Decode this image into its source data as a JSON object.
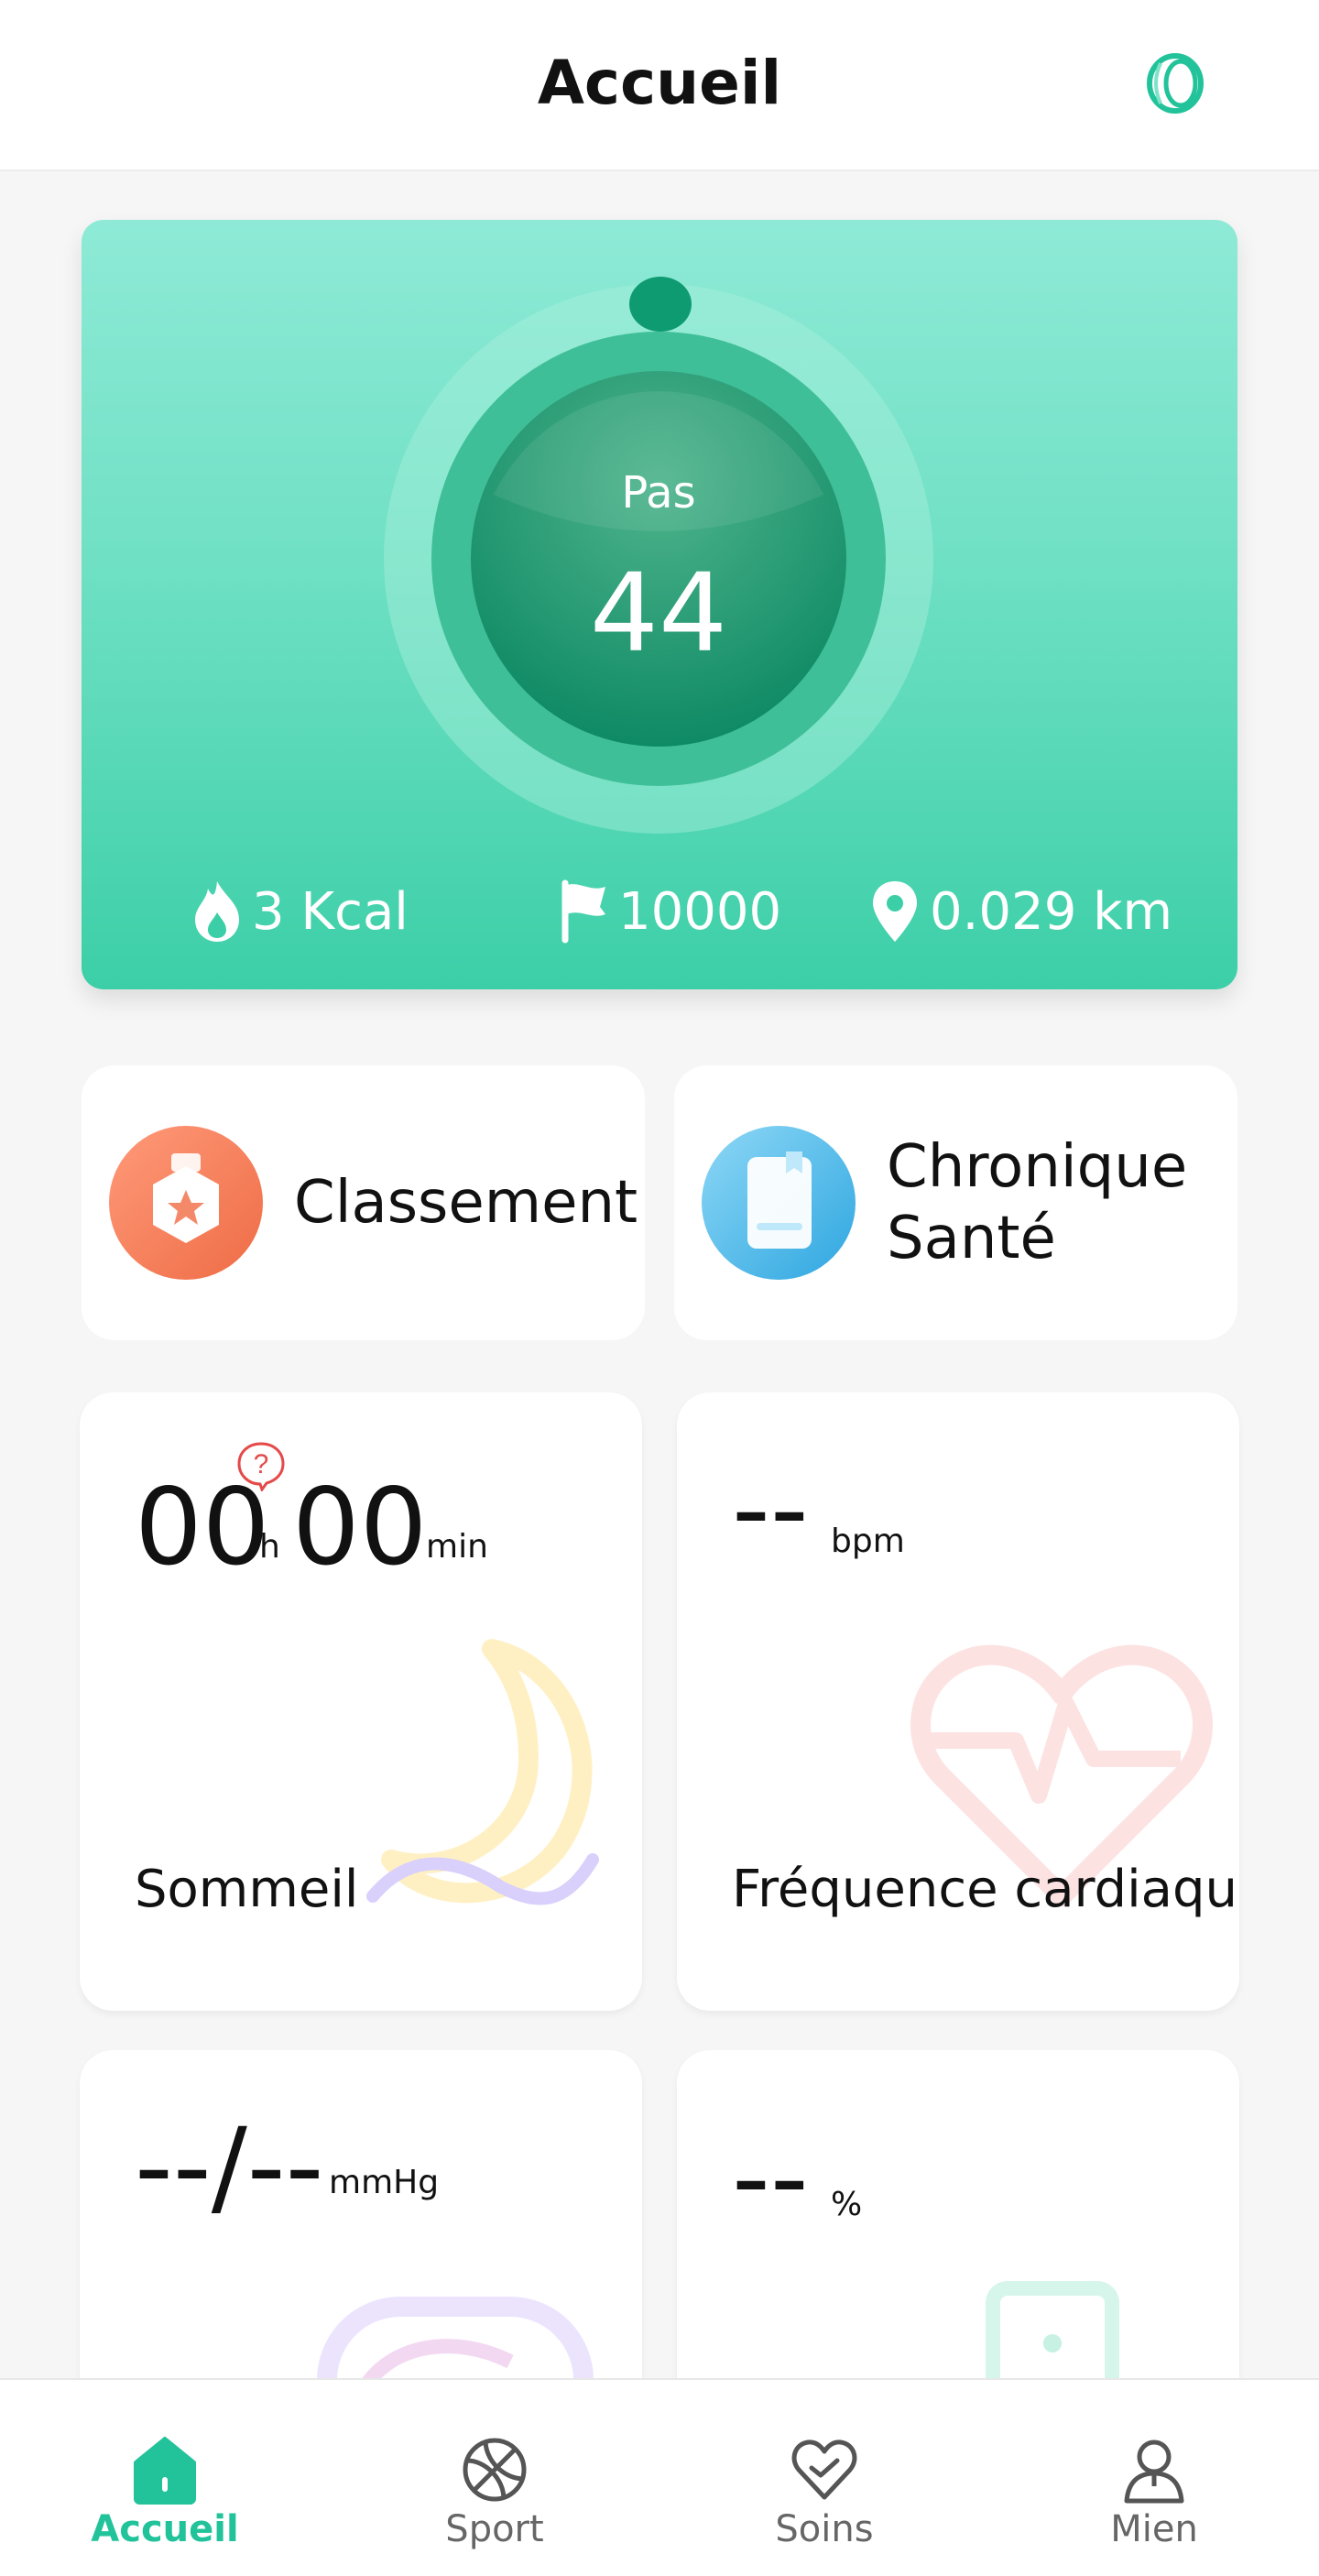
{
  "header": {
    "title": "Accueil",
    "device_icon": "smart-ring-icon"
  },
  "steps_card": {
    "label": "Pas",
    "value": "44",
    "calories": "3 Kcal",
    "goal": "10000",
    "distance": "0.029 km",
    "icons": [
      "flame-icon",
      "flag-icon",
      "location-pin-icon"
    ]
  },
  "quick_cards": [
    {
      "label": "Classement",
      "icon": "ranking-badge-icon"
    },
    {
      "label_line1": "Chronique",
      "label_line2": "Santé",
      "icon": "health-book-icon"
    }
  ],
  "metrics": {
    "sleep": {
      "hours": "00",
      "hours_unit": "h",
      "minutes": "00",
      "minutes_unit": "min",
      "title": "Sommeil",
      "help_icon": "question-bubble-icon"
    },
    "heart_rate": {
      "value": "--",
      "unit": "bpm",
      "title": "Fréquence cardiaque"
    },
    "blood_pressure": {
      "value": "--/--",
      "unit": "mmHg"
    },
    "spo2": {
      "value": "--",
      "unit": "%"
    }
  },
  "bottom_nav": [
    {
      "label": "Accueil",
      "icon": "home-icon",
      "active": true
    },
    {
      "label": "Sport",
      "icon": "sports-ball-icon",
      "active": false
    },
    {
      "label": "Soins",
      "icon": "heart-care-icon",
      "active": false
    },
    {
      "label": "Mien",
      "icon": "profile-icon",
      "active": false
    }
  ],
  "colors": {
    "accent": "#22c39a",
    "card_gradient_top": "#8eead6",
    "card_gradient_bottom": "#3ccfa7"
  }
}
